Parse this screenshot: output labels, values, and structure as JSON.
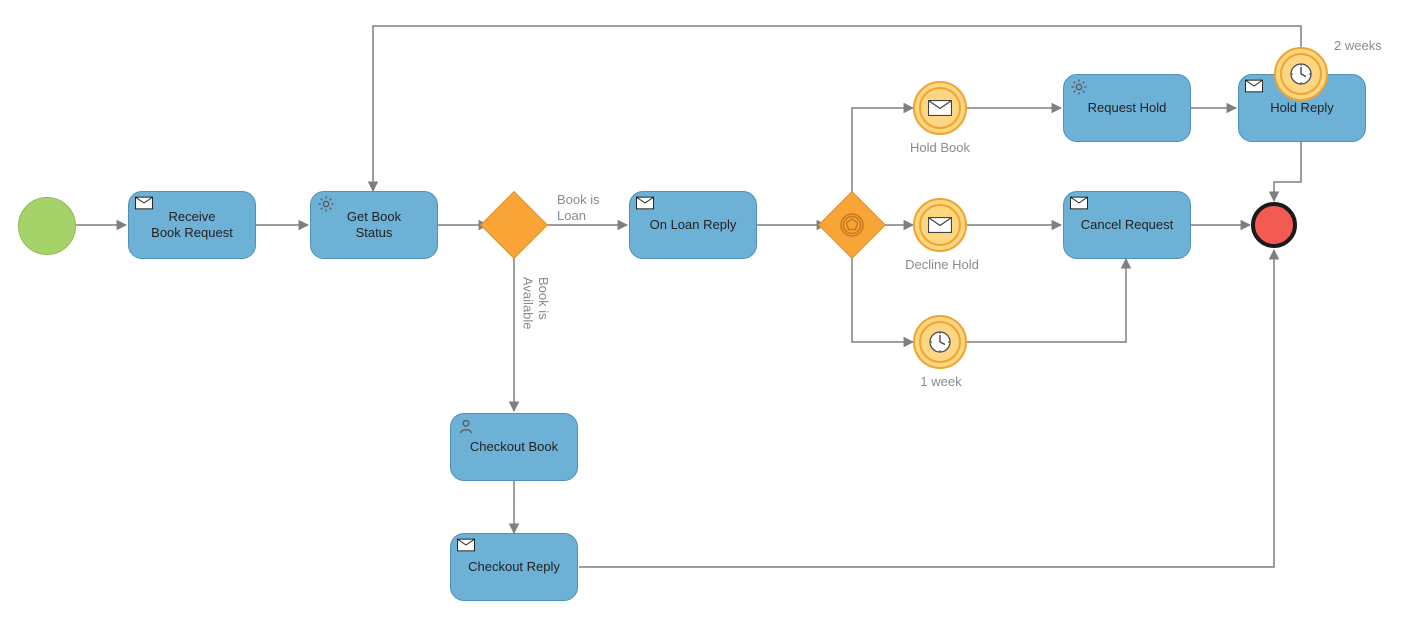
{
  "tasks": {
    "receive": {
      "label": "Receive\nBook Request"
    },
    "get_status": {
      "label": "Get Book\nStatus"
    },
    "on_loan_reply": {
      "label": "On Loan Reply"
    },
    "request_hold": {
      "label": "Request Hold"
    },
    "hold_reply": {
      "label": "Hold Reply"
    },
    "cancel_request": {
      "label": "Cancel Request"
    },
    "checkout_book": {
      "label": "Checkout Book"
    },
    "checkout_reply": {
      "label": "Checkout Reply"
    }
  },
  "events": {
    "hold_book": {
      "label": "Hold Book"
    },
    "decline_hold": {
      "label": "Decline Hold"
    },
    "one_week": {
      "label": "1 week"
    },
    "two_weeks": {
      "label": "2 weeks"
    }
  },
  "edge_labels": {
    "book_is_loan": "Book is\nLoan",
    "book_is_available": "Book is\nAvailable"
  }
}
